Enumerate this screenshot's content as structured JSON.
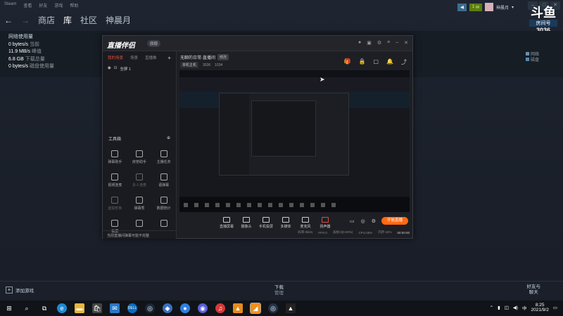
{
  "steam": {
    "menu": [
      "Steam",
      "查看",
      "好友",
      "游戏",
      "帮助"
    ],
    "nav": {
      "store": "商店",
      "library": "库",
      "community": "社区",
      "username": "神晨月"
    },
    "topright": {
      "msg_count": "1",
      "user": "神晨月",
      "dropdown": "▾"
    },
    "room": {
      "logo": "斗鱼",
      "label": "房间号",
      "number": "3036"
    },
    "downloads": {
      "title": "网络使用量",
      "rows": [
        {
          "value": "0 bytes/s",
          "key": "当前"
        },
        {
          "value": "11.9 MB/s",
          "key": "峰值"
        },
        {
          "value": "6.8 GB",
          "key": "下载总量"
        },
        {
          "value": "0 bytes/s",
          "key": "磁盘使用量"
        }
      ],
      "legend": [
        "网络",
        "磁盘"
      ],
      "legend_colors": [
        "#6e8fb0",
        "#4c8dba"
      ]
    },
    "bottom": {
      "add_game": "添加游戏",
      "download_label": "下载",
      "download_sub": "管理",
      "friends_line1": "好友与",
      "friends_line2": "聊天"
    }
  },
  "obs": {
    "logo": "直播伴侣",
    "badge": "旗舰",
    "tabs": [
      "我的场景",
      "场景",
      "直播推",
      "+"
    ],
    "scene_label": "全屏 1",
    "tools_title": "工具箱",
    "tools": [
      {
        "label": "弹幕助手",
        "icon": "danmaku-icon",
        "dim": false
      },
      {
        "label": "房管助手",
        "icon": "admin-icon",
        "dim": false
      },
      {
        "label": "主播任务",
        "icon": "task-icon",
        "dim": false
      },
      {
        "label": "视频连麦",
        "icon": "video-link-icon",
        "dim": false
      },
      {
        "label": "多人连麦",
        "icon": "multi-link-icon",
        "dim": true
      },
      {
        "label": "语弹幕",
        "icon": "voice-danmaku-icon",
        "dim": false
      },
      {
        "label": "虚拟形象",
        "icon": "avatar-icon",
        "dim": true
      },
      {
        "label": "弹幕秀",
        "icon": "danmaku-show-icon",
        "dim": false
      },
      {
        "label": "数据统计",
        "icon": "stats-icon",
        "dim": false
      },
      {
        "label": "投屏",
        "icon": "cast-icon",
        "dim": false
      },
      {
        "label": "",
        "icon": "download-icon",
        "dim": false
      },
      {
        "label": "",
        "icon": "more-icon",
        "dim": false
      }
    ],
    "foot": "当前直播间弹幕可能不完整",
    "room_title": "无聊的日常-直播间",
    "room_tag": "修改",
    "category": "单机主机",
    "room_id": "3036",
    "hot": "1034",
    "controls": [
      "直播屏幕",
      "摄像头",
      "手机投屏",
      "多媒体",
      "麦克风",
      "扬声器"
    ],
    "go_live": "开始直播",
    "status": [
      "码率:0kb/s",
      "FPS:0",
      "丢帧:0(0.00%)",
      "CPU:48%",
      "内存:42%"
    ],
    "time": "00:00:00"
  },
  "taskbar": {
    "icons": [
      "start-icon",
      "search-icon",
      "taskview-icon",
      "edge-icon",
      "explorer-icon",
      "store-icon",
      "mail-icon",
      "dell-icon",
      "steam-icon",
      "app1-icon",
      "app2-icon",
      "app3-icon",
      "netease-icon",
      "orange-app-icon",
      "douyu-app-icon",
      "steam2-icon",
      "game-icon"
    ],
    "time": "8:25",
    "date": "2021/9/2",
    "ime": "中"
  }
}
